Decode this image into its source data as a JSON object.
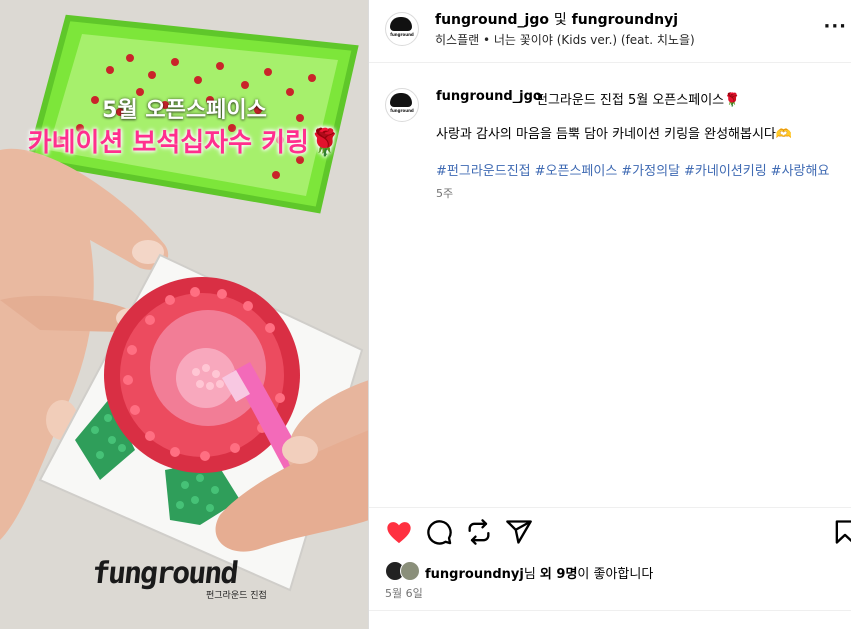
{
  "media": {
    "overlay_line1": "5월 오픈스페이스",
    "overlay_line2": "카네이션 보석십자수 키링🌹",
    "brand_logo": "funground",
    "brand_sub": "펀그라운드 진접"
  },
  "header": {
    "user1": "funground_jgo",
    "conjunction": "및",
    "user2": "fungroundnyj",
    "music": "히스플랜 • 너는 꽃이야 (Kids ver.) (feat. 치노을)",
    "more_icon": "more-horizontal-icon"
  },
  "caption": {
    "username": "funground_jgo",
    "title": "펀그라운드 진접 5월 오픈스페이스🌹",
    "body": "사랑과 감사의 마음을 듬뿍 담아 카네이션 키링을 완성해봅시다🫶",
    "hashtags": [
      "#펀그라운드진접",
      "#오픈스페이스",
      "#가정의달",
      "#카네이션키링",
      "#사랑해요"
    ],
    "time": "5주"
  },
  "actions": {
    "like_icon": "heart-filled-icon",
    "comment_icon": "comment-icon",
    "share_icon": "repost-icon",
    "send_icon": "send-icon",
    "save_icon": "bookmark-icon"
  },
  "likes": {
    "user": "fungroundnyj",
    "suffix1": "님 ",
    "others": "외 9명",
    "suffix2": "이 좋아합니다"
  },
  "date": "5월 6일",
  "colors": {
    "like_red": "#ff3040",
    "hashtag_blue": "#3f6ab3",
    "overlay_pink": "#ff2f8e",
    "tray_green": "#7de63a"
  }
}
